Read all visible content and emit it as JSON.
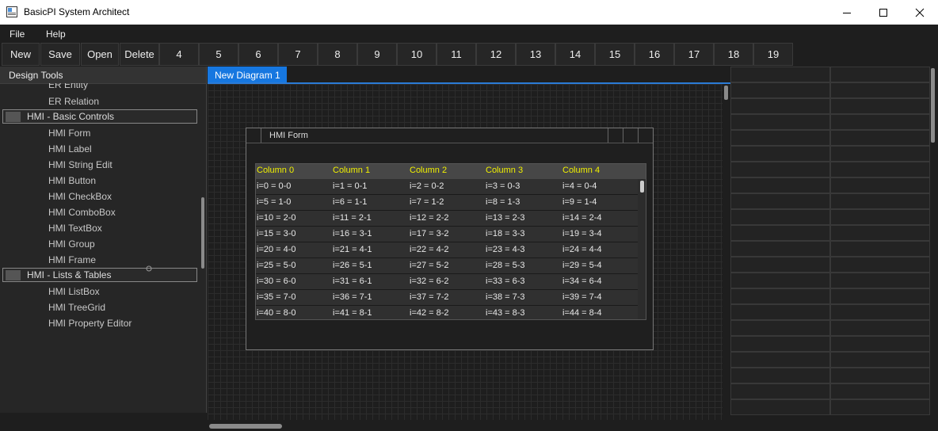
{
  "window": {
    "title": "BasicPI System Architect",
    "minimize": "—",
    "maximize": "☐",
    "close": "✕"
  },
  "menu": [
    "File",
    "Help"
  ],
  "toolbar": [
    "New",
    "Save",
    "Open",
    "Delete",
    "4",
    "5",
    "6",
    "7",
    "8",
    "9",
    "10",
    "11",
    "12",
    "13",
    "14",
    "15",
    "16",
    "17",
    "18",
    "19"
  ],
  "design_tools": {
    "title": "Design Tools",
    "items_top": [
      "ER Entity",
      "ER Relation"
    ],
    "group1": "HMI - Basic Controls",
    "group1_items": [
      "HMI Form",
      "HMI Label",
      "HMI String Edit",
      "HMI Button",
      "HMI CheckBox",
      "HMI ComboBox",
      "HMI TextBox",
      "HMI Group",
      "HMI Frame"
    ],
    "group2": "HMI - Lists & Tables",
    "group2_items": [
      "HMI ListBox",
      "HMI TreeGrid",
      "HMI Property Editor"
    ]
  },
  "diagram_tab": "New Diagram 1",
  "hmi_form": {
    "title": "HMI Form",
    "columns": [
      "Column 0",
      "Column 1",
      "Column 2",
      "Column 3",
      "Column 4"
    ],
    "rows": [
      [
        "i=0 = 0-0",
        "i=1 = 0-1",
        "i=2 = 0-2",
        "i=3 = 0-3",
        "i=4 = 0-4"
      ],
      [
        "i=5 = 1-0",
        "i=6 = 1-1",
        "i=7 = 1-2",
        "i=8 = 1-3",
        "i=9 = 1-4"
      ],
      [
        "i=10 = 2-0",
        "i=11 = 2-1",
        "i=12 = 2-2",
        "i=13 = 2-3",
        "i=14 = 2-4"
      ],
      [
        "i=15 = 3-0",
        "i=16 = 3-1",
        "i=17 = 3-2",
        "i=18 = 3-3",
        "i=19 = 3-4"
      ],
      [
        "i=20 = 4-0",
        "i=21 = 4-1",
        "i=22 = 4-2",
        "i=23 = 4-3",
        "i=24 = 4-4"
      ],
      [
        "i=25 = 5-0",
        "i=26 = 5-1",
        "i=27 = 5-2",
        "i=28 = 5-3",
        "i=29 = 5-4"
      ],
      [
        "i=30 = 6-0",
        "i=31 = 6-1",
        "i=32 = 6-2",
        "i=33 = 6-3",
        "i=34 = 6-4"
      ],
      [
        "i=35 = 7-0",
        "i=36 = 7-1",
        "i=37 = 7-2",
        "i=38 = 7-3",
        "i=39 = 7-4"
      ],
      [
        "i=40 = 8-0",
        "i=41 = 8-1",
        "i=42 = 8-2",
        "i=43 = 8-3",
        "i=44 = 8-4"
      ]
    ]
  },
  "colors": {
    "accent": "#1677e0",
    "header_text": "#f0f000",
    "background": "#1e1e1e"
  }
}
